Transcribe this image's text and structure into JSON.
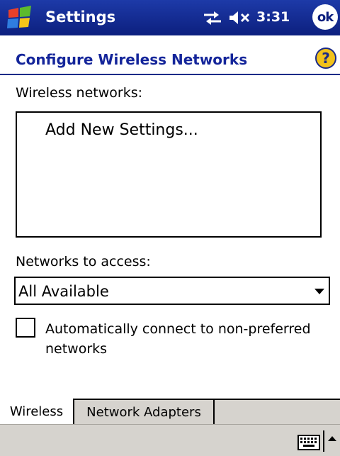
{
  "titlebar": {
    "title": "Settings",
    "time": "3:31",
    "ok_label": "ok",
    "start_icon": "windows-flag-icon",
    "connectivity_icon": "connectivity-arrows-icon",
    "volume_icon": "speaker-muted-icon"
  },
  "header": {
    "title": "Configure Wireless Networks",
    "help_icon": "help-icon"
  },
  "wireless": {
    "label": "Wireless networks:",
    "items": [
      "Add New Settings..."
    ]
  },
  "access": {
    "label": "Networks to access:",
    "selected": "All Available"
  },
  "auto_connect": {
    "label": "Automatically connect to non-preferred networks",
    "checked": false
  },
  "tabs": [
    {
      "label": "Wireless",
      "active": true
    },
    {
      "label": "Network Adapters",
      "active": false
    }
  ],
  "colors": {
    "titlebar": "#0c1f7e",
    "header_text": "#14259a",
    "command_bar": "#d6d3ce"
  }
}
